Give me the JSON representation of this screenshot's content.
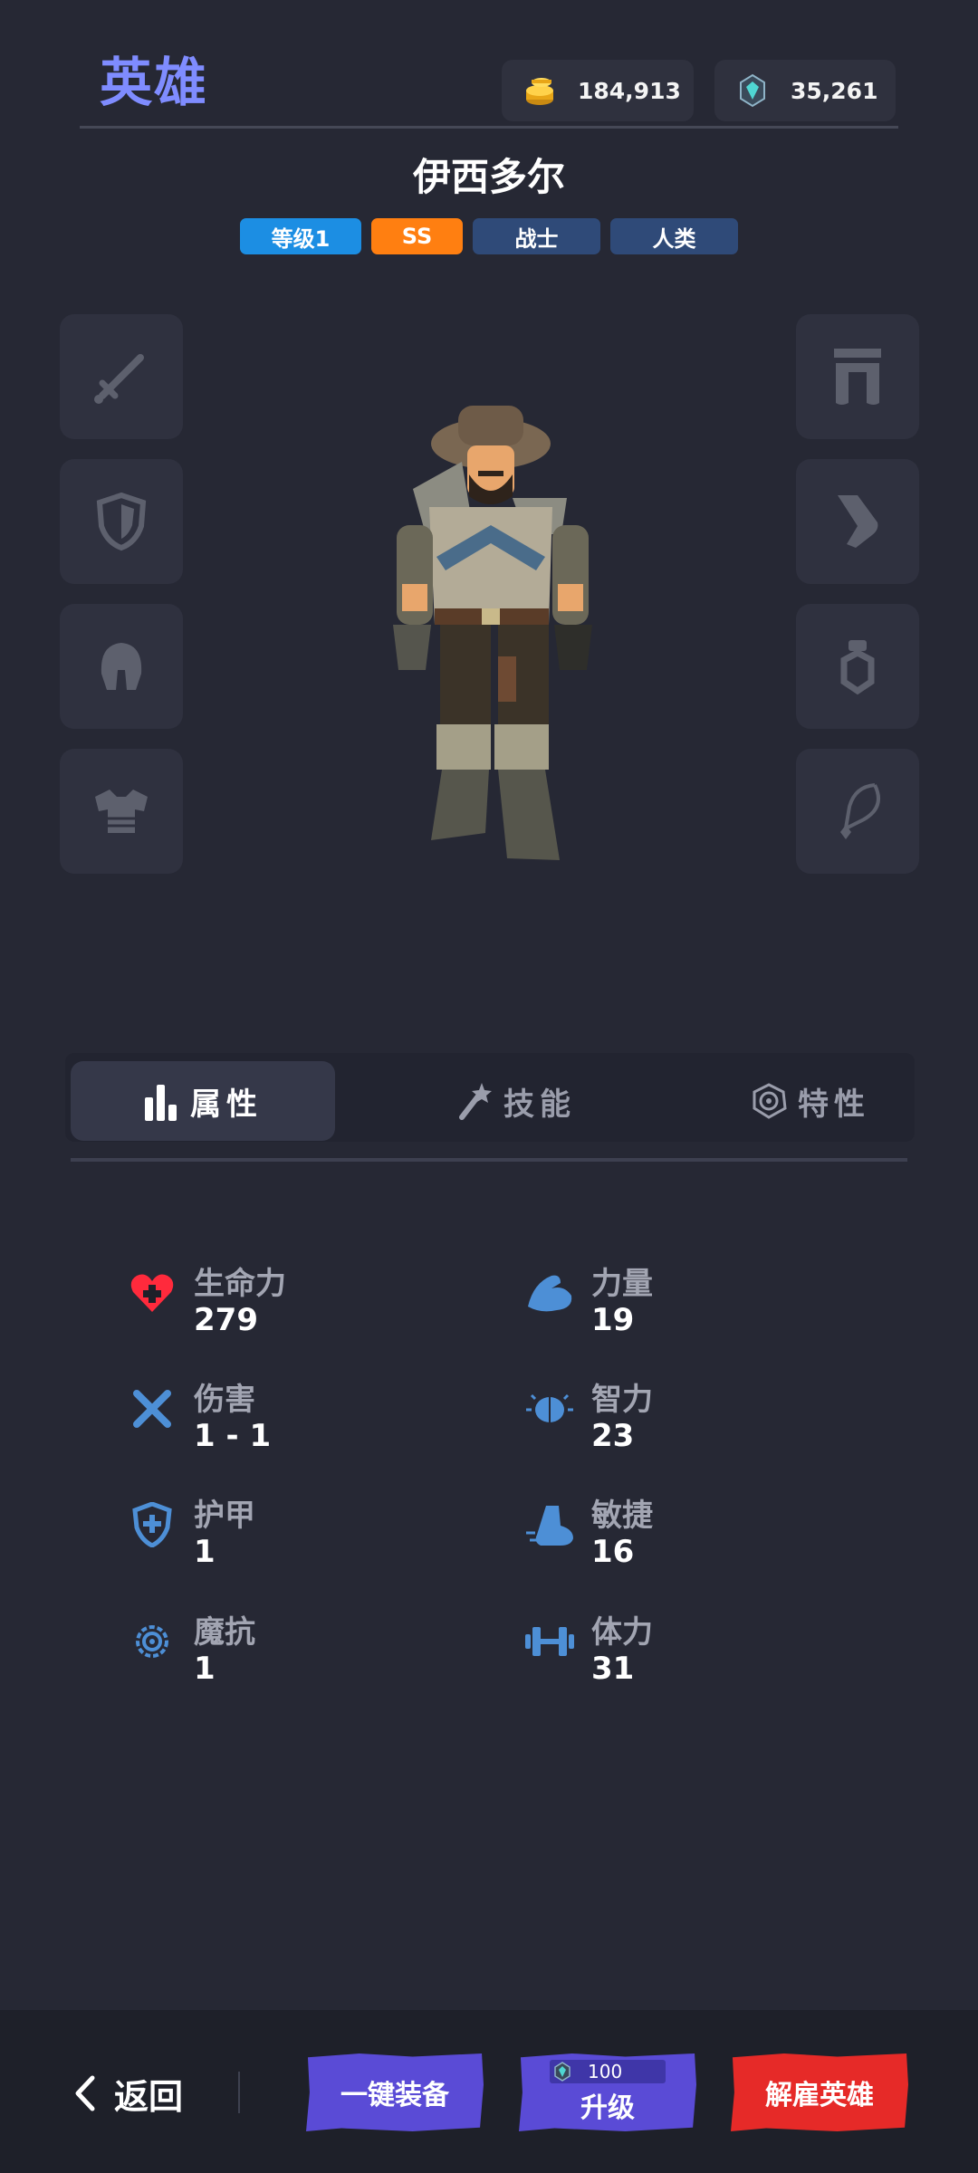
{
  "header": {
    "title": "英雄",
    "gold": "184,913",
    "gems": "35,261"
  },
  "hero": {
    "name": "伊西多尔",
    "tags": {
      "level": "等级1",
      "rank": "SS",
      "class": "战士",
      "race": "人类"
    }
  },
  "equipment_slots": {
    "left": [
      "sword-icon",
      "shield-icon",
      "helmet-icon",
      "armor-icon"
    ],
    "right": [
      "pants-icon",
      "boots-icon",
      "ring-icon",
      "necklace-icon"
    ]
  },
  "tabs": {
    "attributes": "属性",
    "skills": "技能",
    "traits": "特性"
  },
  "stats": {
    "health": {
      "label": "生命力",
      "value": "279"
    },
    "strength": {
      "label": "力量",
      "value": "19"
    },
    "damage": {
      "label": "伤害",
      "value": "1 - 1"
    },
    "intelligence": {
      "label": "智力",
      "value": "23"
    },
    "armor": {
      "label": "护甲",
      "value": "1"
    },
    "agility": {
      "label": "敏捷",
      "value": "16"
    },
    "magic_resist": {
      "label": "魔抗",
      "value": "1"
    },
    "stamina": {
      "label": "体力",
      "value": "31"
    }
  },
  "bottom": {
    "back": "返回",
    "equip_all": "一键装备",
    "upgrade": "升级",
    "upgrade_cost": "100",
    "hire": "解雇英雄"
  },
  "colors": {
    "accent": "#7f8cff",
    "level_tag": "#1c8ee3",
    "rank_tag": "#ff7f11",
    "class_tag": "#2f4a78",
    "stat_icon": "#4d8fd6",
    "health_icon": "#ff2a3c",
    "primary_button": "#5a4bd6",
    "danger_button": "#e62a28"
  }
}
